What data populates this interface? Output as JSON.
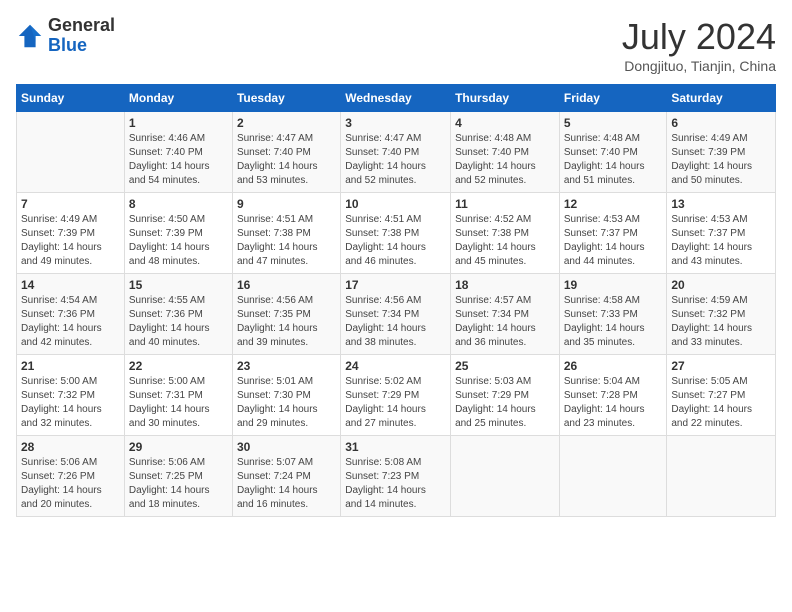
{
  "logo": {
    "general": "General",
    "blue": "Blue"
  },
  "header": {
    "month": "July 2024",
    "location": "Dongjituo, Tianjin, China"
  },
  "weekdays": [
    "Sunday",
    "Monday",
    "Tuesday",
    "Wednesday",
    "Thursday",
    "Friday",
    "Saturday"
  ],
  "weeks": [
    [
      {
        "day": "",
        "detail": ""
      },
      {
        "day": "1",
        "detail": "Sunrise: 4:46 AM\nSunset: 7:40 PM\nDaylight: 14 hours\nand 54 minutes."
      },
      {
        "day": "2",
        "detail": "Sunrise: 4:47 AM\nSunset: 7:40 PM\nDaylight: 14 hours\nand 53 minutes."
      },
      {
        "day": "3",
        "detail": "Sunrise: 4:47 AM\nSunset: 7:40 PM\nDaylight: 14 hours\nand 52 minutes."
      },
      {
        "day": "4",
        "detail": "Sunrise: 4:48 AM\nSunset: 7:40 PM\nDaylight: 14 hours\nand 52 minutes."
      },
      {
        "day": "5",
        "detail": "Sunrise: 4:48 AM\nSunset: 7:40 PM\nDaylight: 14 hours\nand 51 minutes."
      },
      {
        "day": "6",
        "detail": "Sunrise: 4:49 AM\nSunset: 7:39 PM\nDaylight: 14 hours\nand 50 minutes."
      }
    ],
    [
      {
        "day": "7",
        "detail": "Sunrise: 4:49 AM\nSunset: 7:39 PM\nDaylight: 14 hours\nand 49 minutes."
      },
      {
        "day": "8",
        "detail": "Sunrise: 4:50 AM\nSunset: 7:39 PM\nDaylight: 14 hours\nand 48 minutes."
      },
      {
        "day": "9",
        "detail": "Sunrise: 4:51 AM\nSunset: 7:38 PM\nDaylight: 14 hours\nand 47 minutes."
      },
      {
        "day": "10",
        "detail": "Sunrise: 4:51 AM\nSunset: 7:38 PM\nDaylight: 14 hours\nand 46 minutes."
      },
      {
        "day": "11",
        "detail": "Sunrise: 4:52 AM\nSunset: 7:38 PM\nDaylight: 14 hours\nand 45 minutes."
      },
      {
        "day": "12",
        "detail": "Sunrise: 4:53 AM\nSunset: 7:37 PM\nDaylight: 14 hours\nand 44 minutes."
      },
      {
        "day": "13",
        "detail": "Sunrise: 4:53 AM\nSunset: 7:37 PM\nDaylight: 14 hours\nand 43 minutes."
      }
    ],
    [
      {
        "day": "14",
        "detail": "Sunrise: 4:54 AM\nSunset: 7:36 PM\nDaylight: 14 hours\nand 42 minutes."
      },
      {
        "day": "15",
        "detail": "Sunrise: 4:55 AM\nSunset: 7:36 PM\nDaylight: 14 hours\nand 40 minutes."
      },
      {
        "day": "16",
        "detail": "Sunrise: 4:56 AM\nSunset: 7:35 PM\nDaylight: 14 hours\nand 39 minutes."
      },
      {
        "day": "17",
        "detail": "Sunrise: 4:56 AM\nSunset: 7:34 PM\nDaylight: 14 hours\nand 38 minutes."
      },
      {
        "day": "18",
        "detail": "Sunrise: 4:57 AM\nSunset: 7:34 PM\nDaylight: 14 hours\nand 36 minutes."
      },
      {
        "day": "19",
        "detail": "Sunrise: 4:58 AM\nSunset: 7:33 PM\nDaylight: 14 hours\nand 35 minutes."
      },
      {
        "day": "20",
        "detail": "Sunrise: 4:59 AM\nSunset: 7:32 PM\nDaylight: 14 hours\nand 33 minutes."
      }
    ],
    [
      {
        "day": "21",
        "detail": "Sunrise: 5:00 AM\nSunset: 7:32 PM\nDaylight: 14 hours\nand 32 minutes."
      },
      {
        "day": "22",
        "detail": "Sunrise: 5:00 AM\nSunset: 7:31 PM\nDaylight: 14 hours\nand 30 minutes."
      },
      {
        "day": "23",
        "detail": "Sunrise: 5:01 AM\nSunset: 7:30 PM\nDaylight: 14 hours\nand 29 minutes."
      },
      {
        "day": "24",
        "detail": "Sunrise: 5:02 AM\nSunset: 7:29 PM\nDaylight: 14 hours\nand 27 minutes."
      },
      {
        "day": "25",
        "detail": "Sunrise: 5:03 AM\nSunset: 7:29 PM\nDaylight: 14 hours\nand 25 minutes."
      },
      {
        "day": "26",
        "detail": "Sunrise: 5:04 AM\nSunset: 7:28 PM\nDaylight: 14 hours\nand 23 minutes."
      },
      {
        "day": "27",
        "detail": "Sunrise: 5:05 AM\nSunset: 7:27 PM\nDaylight: 14 hours\nand 22 minutes."
      }
    ],
    [
      {
        "day": "28",
        "detail": "Sunrise: 5:06 AM\nSunset: 7:26 PM\nDaylight: 14 hours\nand 20 minutes."
      },
      {
        "day": "29",
        "detail": "Sunrise: 5:06 AM\nSunset: 7:25 PM\nDaylight: 14 hours\nand 18 minutes."
      },
      {
        "day": "30",
        "detail": "Sunrise: 5:07 AM\nSunset: 7:24 PM\nDaylight: 14 hours\nand 16 minutes."
      },
      {
        "day": "31",
        "detail": "Sunrise: 5:08 AM\nSunset: 7:23 PM\nDaylight: 14 hours\nand 14 minutes."
      },
      {
        "day": "",
        "detail": ""
      },
      {
        "day": "",
        "detail": ""
      },
      {
        "day": "",
        "detail": ""
      }
    ]
  ]
}
